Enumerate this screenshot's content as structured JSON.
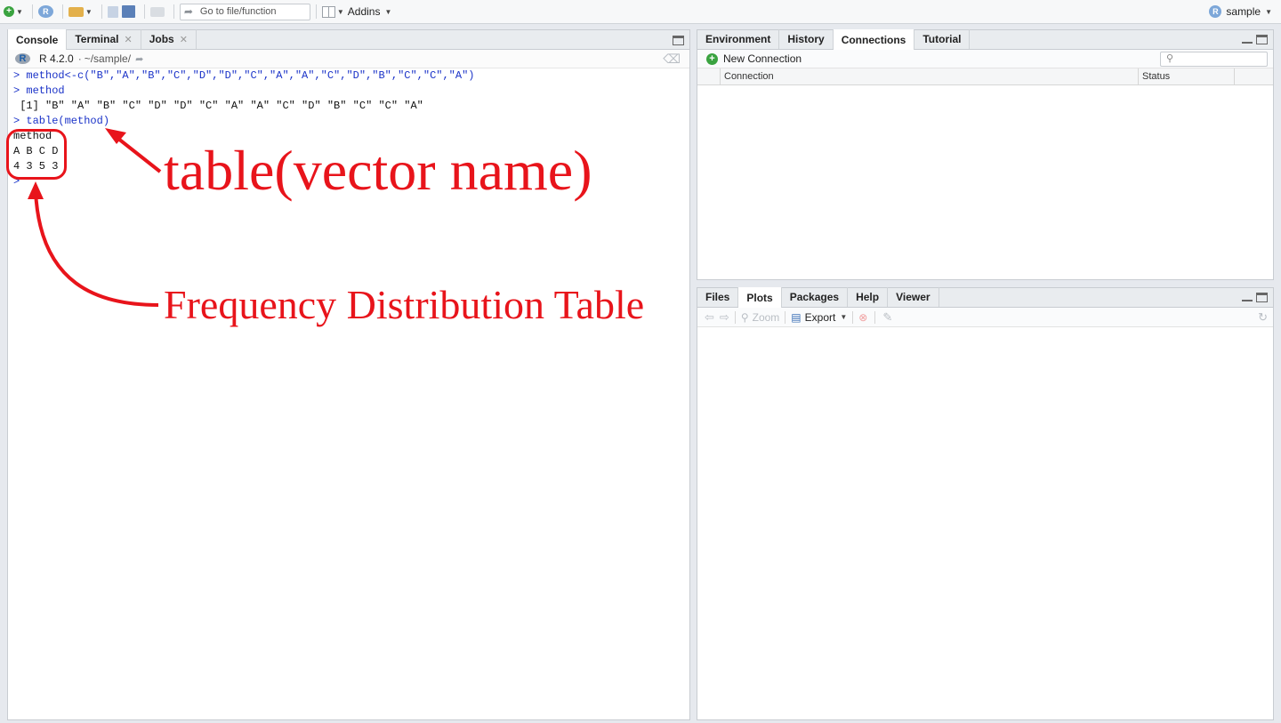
{
  "toolbar": {
    "goto_placeholder": "Go to file/function",
    "addins_label": "Addins",
    "project_label": "sample"
  },
  "left_pane": {
    "tabs": [
      {
        "label": "Console",
        "closable": false,
        "active": true
      },
      {
        "label": "Terminal",
        "closable": true,
        "active": false
      },
      {
        "label": "Jobs",
        "closable": true,
        "active": false
      }
    ],
    "r_version": "R 4.2.0",
    "separator": "·",
    "working_dir": "~/sample/",
    "console_lines": [
      {
        "text": "> method<-c(\"B\",\"A\",\"B\",\"C\",\"D\",\"D\",\"C\",\"A\",\"A\",\"C\",\"D\",\"B\",\"C\",\"C\",\"A\")",
        "kind": "in"
      },
      {
        "text": "> method",
        "kind": "in"
      },
      {
        "text": " [1] \"B\" \"A\" \"B\" \"C\" \"D\" \"D\" \"C\" \"A\" \"A\" \"C\" \"D\" \"B\" \"C\" \"C\" \"A\"",
        "kind": "out"
      },
      {
        "text": "> table(method)",
        "kind": "in"
      },
      {
        "text": "method",
        "kind": "out"
      },
      {
        "text": "A B C D",
        "kind": "out"
      },
      {
        "text": "4 3 5 3",
        "kind": "out"
      },
      {
        "text": ">",
        "kind": "in"
      }
    ]
  },
  "annotations": {
    "table_label": "table(vector name)",
    "freq_label": "Frequency Distribution Table"
  },
  "top_right_pane": {
    "tabs": [
      {
        "label": "Environment",
        "active": false
      },
      {
        "label": "History",
        "active": false
      },
      {
        "label": "Connections",
        "active": true
      },
      {
        "label": "Tutorial",
        "active": false
      }
    ],
    "new_connection_label": "New Connection",
    "columns": [
      "Connection",
      "Status"
    ]
  },
  "bottom_right_pane": {
    "tabs": [
      {
        "label": "Files",
        "active": false
      },
      {
        "label": "Plots",
        "active": true
      },
      {
        "label": "Packages",
        "active": false
      },
      {
        "label": "Help",
        "active": false
      },
      {
        "label": "Viewer",
        "active": false
      }
    ],
    "zoom_label": "Zoom",
    "export_label": "Export"
  },
  "colors": {
    "annotation": "#e8141b",
    "console_input": "#1a32c8"
  }
}
